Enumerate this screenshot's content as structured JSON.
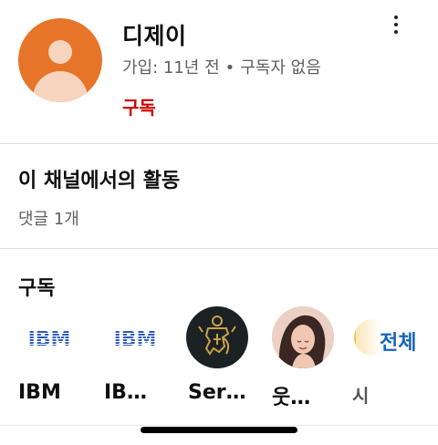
{
  "channel": {
    "name": "디제이",
    "joined": "가입: 11년 전",
    "separator": "•",
    "subscribers": "구독자 없음",
    "subscribe_label": "구독",
    "avatar_color": "#e67529"
  },
  "activity": {
    "title": "이 채널에서의 활동",
    "comments": "댓글 1개"
  },
  "subscriptions": {
    "title": "구독",
    "view_all_label": "전체",
    "items": [
      {
        "label": "IBM",
        "logo": "IBM",
        "icon": "ibm-logo-icon"
      },
      {
        "label": "IB…",
        "logo": "IBM",
        "icon": "ibm-logo-icon"
      },
      {
        "label": "Ser…",
        "icon": "lion-crest-icon"
      },
      {
        "label": "웃…",
        "icon": "profile-photo"
      },
      {
        "label": "시",
        "icon": "yellow-avatar"
      }
    ]
  },
  "colors": {
    "accent_red": "#cc0000",
    "link_blue": "#1565c0",
    "ibm_blue": "#2b59c3"
  }
}
